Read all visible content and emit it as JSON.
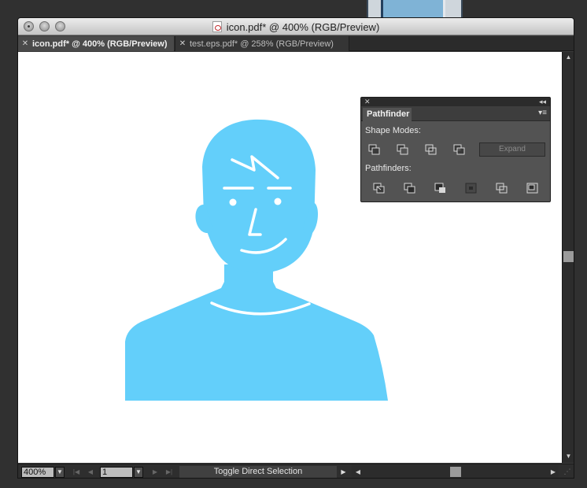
{
  "window": {
    "title": "icon.pdf* @ 400% (RGB/Preview)"
  },
  "tabs": [
    {
      "label": "icon.pdf* @ 400% (RGB/Preview)",
      "close": "✕",
      "active": true
    },
    {
      "label": "test.eps.pdf* @ 258% (RGB/Preview)",
      "close": "✕",
      "active": false
    }
  ],
  "artwork": {
    "figure_color": "#63cffa",
    "canvas_color": "#ffffff"
  },
  "pathfinder_panel": {
    "close_glyph": "✕",
    "collapse_glyph": "◂◂",
    "tab_label": "Pathfinder",
    "menu_glyph": "▾≡",
    "shape_modes_label": "Shape Modes:",
    "shape_mode_buttons": [
      "unite-icon",
      "minus-front-icon",
      "intersect-icon",
      "exclude-icon"
    ],
    "expand_label": "Expand",
    "pathfinders_label": "Pathfinders:",
    "pathfinder_buttons": [
      "divide-icon",
      "trim-icon",
      "merge-icon",
      "crop-icon",
      "outline-icon",
      "minus-back-icon"
    ]
  },
  "statusbar": {
    "zoom_value": "400%",
    "artboard_value": "1",
    "status_label": "Toggle Direct Selection"
  }
}
